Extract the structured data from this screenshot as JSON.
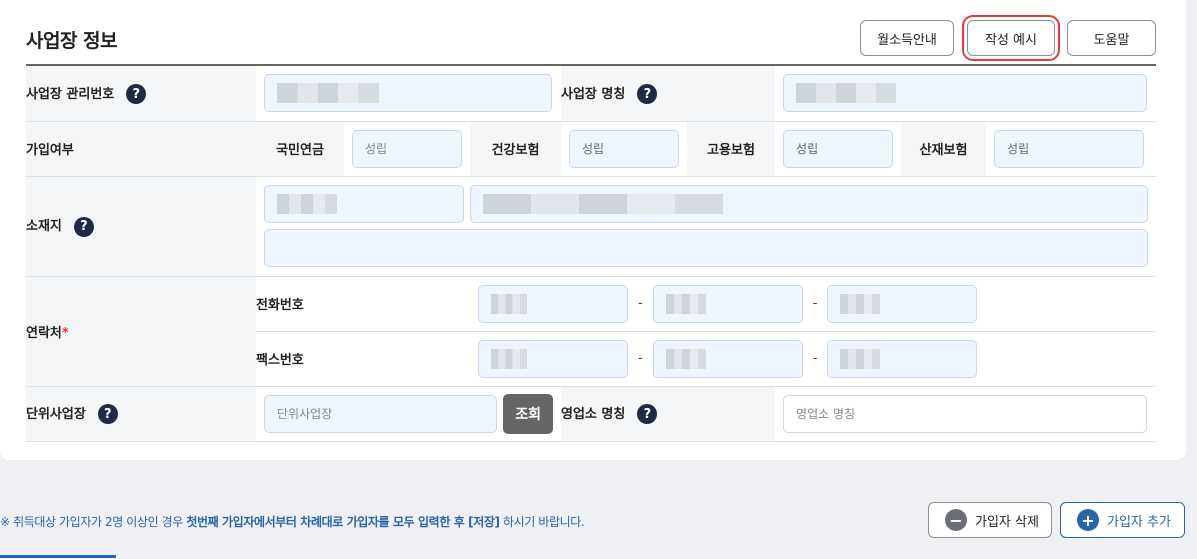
{
  "section": {
    "title": "사업장 정보",
    "buttons": {
      "monthly_income": "월소득안내",
      "example": "작성 예시",
      "help": "도움말"
    }
  },
  "fields": {
    "biz_mgmt_no": "사업장 관리번호",
    "biz_name": "사업장 명칭",
    "join_status": "가입여부",
    "pension": "국민연금",
    "health": "건강보험",
    "employment": "고용보험",
    "industrial": "산재보험",
    "status_value": "성립",
    "location": "소재지",
    "contact": "연락처",
    "required_mark": "*",
    "phone": "전화번호",
    "fax": "팩스번호",
    "dash": "-",
    "unit_biz": "단위사업장",
    "unit_biz_placeholder": "단위사업장",
    "search_button": "조회",
    "branch_name": "영업소 명칭",
    "branch_name_placeholder": "영업소 명칭",
    "help_glyph": "?"
  },
  "footer": {
    "notice_prefix": "※ 취득대상 가입자가 2명 이상인 경우 ",
    "notice_bold": "첫번째 가입자에서부터 차례대로 가입자를 모두 입력한 후 [저장]",
    "notice_suffix": " 하시기 바랍니다.",
    "delete_button": "가입자 삭제",
    "add_button": "가입자 추가",
    "minus_glyph": "−",
    "plus_glyph": "+"
  },
  "colors": {
    "accent": "#2a65a8",
    "highlight": "#e53935",
    "input_bg": "#eef5ff"
  }
}
